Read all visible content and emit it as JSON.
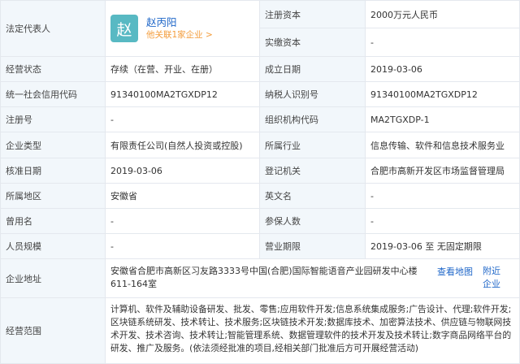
{
  "rows": {
    "legal_rep": {
      "label": "法定代表人",
      "avatar_char": "赵",
      "name": "赵丙阳",
      "sub": "他关联1家企业 >"
    },
    "reg_capital": {
      "label": "注册资本",
      "value": "2000万元人民币"
    },
    "paid_capital": {
      "label": "实缴资本",
      "value": "-"
    },
    "status": {
      "label": "经营状态",
      "value": "存续（在营、开业、在册）"
    },
    "est_date": {
      "label": "成立日期",
      "value": "2019-03-06"
    },
    "credit_code": {
      "label": "统一社会信用代码",
      "value": "91340100MA2TGXDP12"
    },
    "taxpayer_id": {
      "label": "纳税人识别号",
      "value": "91340100MA2TGXDP12"
    },
    "reg_no": {
      "label": "注册号",
      "value": "-"
    },
    "org_code": {
      "label": "组织机构代码",
      "value": "MA2TGXDP-1"
    },
    "company_type": {
      "label": "企业类型",
      "value": "有限责任公司(自然人投资或控股)"
    },
    "industry": {
      "label": "所属行业",
      "value": "信息传输、软件和信息技术服务业"
    },
    "approve_date": {
      "label": "核准日期",
      "value": "2019-03-06"
    },
    "authority": {
      "label": "登记机关",
      "value": "合肥市高新开发区市场监督管理局"
    },
    "region": {
      "label": "所属地区",
      "value": "安徽省"
    },
    "english_name": {
      "label": "英文名",
      "value": "-"
    },
    "former_name": {
      "label": "曾用名",
      "value": "-"
    },
    "insured": {
      "label": "参保人数",
      "value": "-"
    },
    "staff_size": {
      "label": "人员规模",
      "value": "-"
    },
    "term": {
      "label": "营业期限",
      "value": "2019-03-06 至 无固定期限"
    },
    "address": {
      "label": "企业地址",
      "value": "安徽省合肥市高新区习友路3333号中国(合肥)国际智能语音产业园研发中心楼611-164室",
      "map_link": "查看地图",
      "nearby_link": "附近企业"
    },
    "scope": {
      "label": "经营范围",
      "value": "计算机、软件及辅助设备研发、批发、零售;应用软件开发;信息系统集成服务;广告设计、代理;软件开发;区块链系统研发、技术转让、技术服务;区块链技术开发;数据库技术、加密算法技术、供应链与物联网技术开发、技术咨询、技术转让;智能管理系统、数据管理软件的技术开发及技术转让;数字商品网络平台的研发、推广及服务。(依法须经批准的项目,经相关部门批准后方可开展经营活动)"
    }
  }
}
